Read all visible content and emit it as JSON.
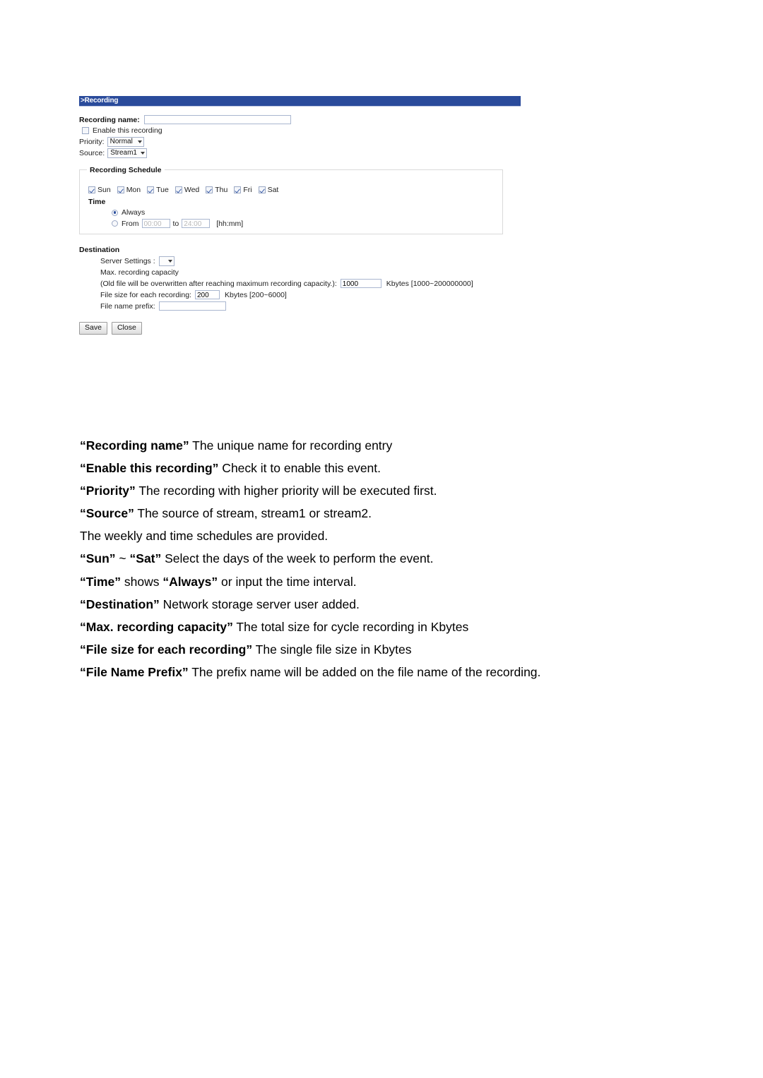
{
  "ui": {
    "title_bar": {
      "text": ">Recording"
    },
    "recording_name": {
      "label": "Recording name:",
      "value": "",
      "placeholder": ""
    },
    "enable_recording": {
      "label": "Enable this recording",
      "checked": false
    },
    "priority": {
      "label": "Priority:",
      "value": "Normal"
    },
    "source": {
      "label": "Source:",
      "value": "Stream1"
    },
    "schedule": {
      "legend": "Recording Schedule",
      "days": [
        {
          "label": "Sun",
          "checked": true
        },
        {
          "label": "Mon",
          "checked": true
        },
        {
          "label": "Tue",
          "checked": true
        },
        {
          "label": "Wed",
          "checked": true
        },
        {
          "label": "Thu",
          "checked": true
        },
        {
          "label": "Fri",
          "checked": true
        },
        {
          "label": "Sat",
          "checked": true
        }
      ],
      "time_heading": "Time",
      "always_label": "Always",
      "always_selected": true,
      "from_label": "From",
      "from_value": "00:00",
      "to_label": "to",
      "to_value": "24:00",
      "format_hint": "[hh:mm]",
      "from_selected": false
    },
    "destination": {
      "heading": "Destination",
      "server_settings_label": "Server Settings :",
      "server_settings_value": "",
      "max_capacity_label": "Max. recording capacity",
      "max_capacity_note": "(Old file will be overwritten after reaching maximum recording capacity.):",
      "max_capacity_value": "1000",
      "max_capacity_unit": "Kbytes [1000~200000000]",
      "file_size_label": "File size for each recording:",
      "file_size_value": "200",
      "file_size_unit": "Kbytes [200~6000]",
      "prefix_label": "File name prefix:",
      "prefix_value": ""
    },
    "buttons": {
      "save": "Save",
      "close": "Close"
    },
    "colors": {
      "title_bar_bg": "#2a4b9b",
      "title_bar_text": "#ffffff",
      "input_border": "#a9b6cf",
      "fieldset_border": "#d9d9d9"
    }
  },
  "explanations": [
    {
      "term": "“Recording name”",
      "text": " The unique name for recording entry"
    },
    {
      "term": "“Enable this recording”",
      "text": " Check it to enable this event."
    },
    {
      "term": "“Priority”",
      "text": " The recording with higher priority will be executed first."
    },
    {
      "term": "“Source”",
      "text": " The source of stream, stream1 or stream2."
    },
    {
      "term": "",
      "text": "The weekly and time schedules are provided."
    },
    {
      "term": "“Sun” ~ “Sat”",
      "text": " Select the days of the week to perform the event.",
      "bold_segments": [
        "“Sun”",
        " ~ ",
        "“Sat”"
      ]
    },
    {
      "term": "“Time”",
      "text": " shows “Always” or input the time interval."
    },
    {
      "term": "“Destination”",
      "text": " Network storage server user added."
    },
    {
      "term": "“Max. recording capacity”",
      "text": " The total size for cycle recording in Kbytes"
    },
    {
      "term": "“File size for each recording”",
      "text": " The single file size in Kbytes"
    },
    {
      "term": "“File Name Prefix”",
      "text": " The prefix name will be added on the file name of the recording."
    }
  ],
  "explanation_lines": {
    "l0_term": "“Recording name”",
    "l0_rest": " The unique name for recording entry",
    "l1_term": "“Enable this recording”",
    "l1_rest": " Check it to enable this event.",
    "l2_term": "“Priority”",
    "l2_rest": " The recording with higher priority will be executed first.",
    "l3_term": "“Source”",
    "l3_rest": " The source of stream, stream1 or stream2.",
    "l4_rest": "The weekly and time schedules are provided.",
    "l5_term": "“Sun”",
    "l5_mid": " ~ ",
    "l5_term2": "“Sat”",
    "l5_rest": " Select the days of the week to perform the event.",
    "l6_term": "“Time”",
    "l6_mid": " shows ",
    "l6_term2": "“Always”",
    "l6_rest": " or input the time interval.",
    "l7_term": "“Destination”",
    "l7_rest": " Network storage server user added.",
    "l8_term": "“Max. recording capacity”",
    "l8_rest": " The total size for cycle recording in Kbytes",
    "l9_term": "“File size for each recording”",
    "l9_rest": " The single file size in Kbytes",
    "l10_term": "“File Name Prefix”",
    "l10_rest": " The prefix name will be added on the file name of the recording."
  }
}
